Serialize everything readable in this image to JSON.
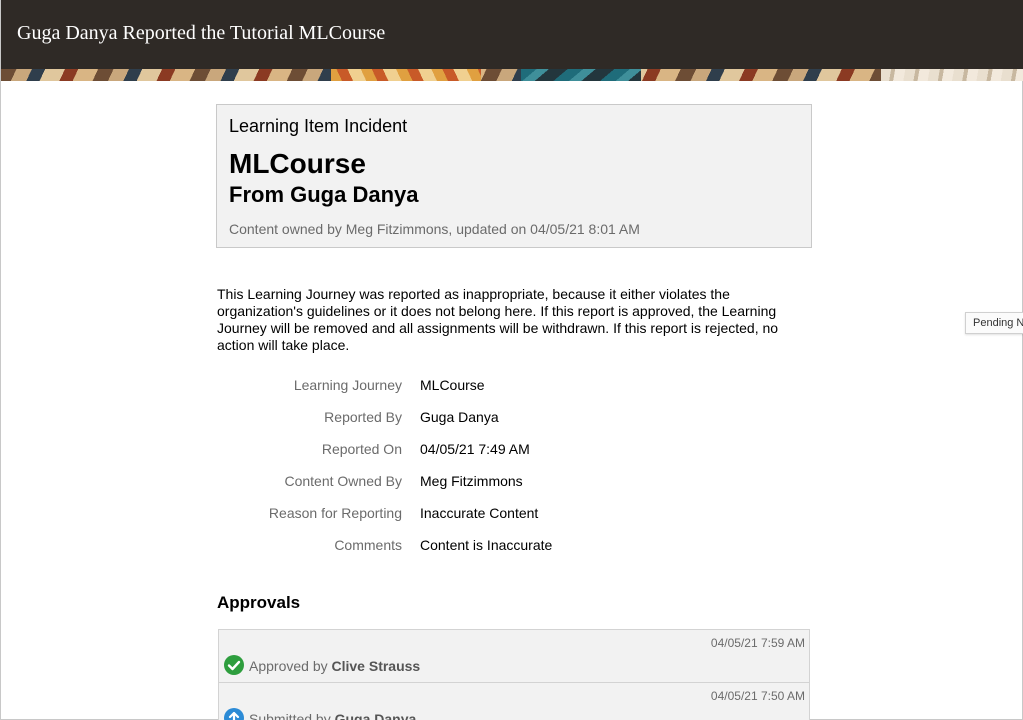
{
  "window": {
    "title": "Guga Danya Reported the Tutorial MLCourse"
  },
  "side_tab": {
    "label": "Pending N"
  },
  "header": {
    "label": "Learning Item Incident",
    "title": "MLCourse",
    "subtitle": "From Guga Danya",
    "meta": "Content owned by Meg Fitzimmons, updated on 04/05/21 8:01 AM"
  },
  "description": "This Learning Journey was reported as inappropriate, because it either violates the organization's guidelines or it does not belong here. If this report is approved, the Learning Journey will be removed and all assignments will be withdrawn. If this report is rejected, no action will take place.",
  "details": [
    {
      "label": "Learning Journey",
      "value": "MLCourse"
    },
    {
      "label": "Reported By",
      "value": "Guga Danya"
    },
    {
      "label": "Reported On",
      "value": "04/05/21 7:49 AM"
    },
    {
      "label": "Content Owned By",
      "value": "Meg Fitzimmons"
    },
    {
      "label": "Reason for Reporting",
      "value": "Inaccurate Content"
    },
    {
      "label": "Comments",
      "value": "Content is Inaccurate"
    }
  ],
  "approvals": {
    "heading": "Approvals",
    "items": [
      {
        "time": "04/05/21 7:59 AM",
        "action": "Approved by",
        "person": "Clive Strauss",
        "icon": "check-circle-icon",
        "color": "#2e9e3e"
      },
      {
        "time": "04/05/21 7:50 AM",
        "action": "Submitted by",
        "person": "Guga Danya",
        "icon": "arrow-up-circle-icon",
        "color": "#2c8bd6"
      }
    ]
  }
}
